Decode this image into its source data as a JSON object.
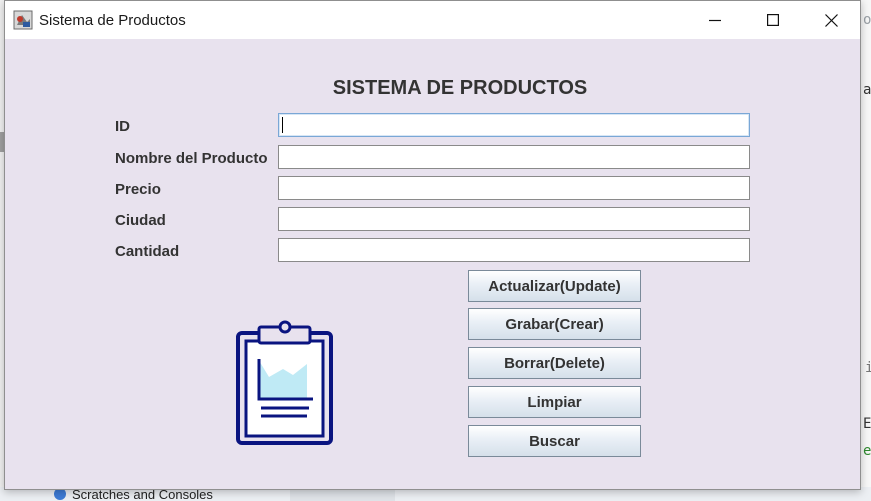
{
  "window": {
    "title": "Sistema de Productos",
    "controls": {
      "minimize": "minimize",
      "maximize": "maximize",
      "close": "close"
    }
  },
  "form": {
    "heading": "SISTEMA DE PRODUCTOS",
    "fields": [
      {
        "label": "ID",
        "value": "",
        "focused": true
      },
      {
        "label": "Nombre del Producto",
        "value": ""
      },
      {
        "label": "Precio",
        "value": ""
      },
      {
        "label": "Ciudad",
        "value": ""
      },
      {
        "label": "Cantidad",
        "value": ""
      }
    ],
    "buttons": [
      "Actualizar(Update)",
      "Grabar(Crear)",
      "Borrar(Delete)",
      "Limpiar",
      "Buscar"
    ],
    "illustration_icon": "clipboard-chart-icon"
  },
  "background": {
    "project_tree_item": "Scratches and Consoles",
    "editor_fragments": [
      "og",
      "a",
      "i",
      "E",
      "e"
    ]
  },
  "colors": {
    "window_bg": "#e8e2ee",
    "text": "#333333",
    "icon_navy": "#0a1480",
    "icon_fill": "#bfeaf5"
  }
}
